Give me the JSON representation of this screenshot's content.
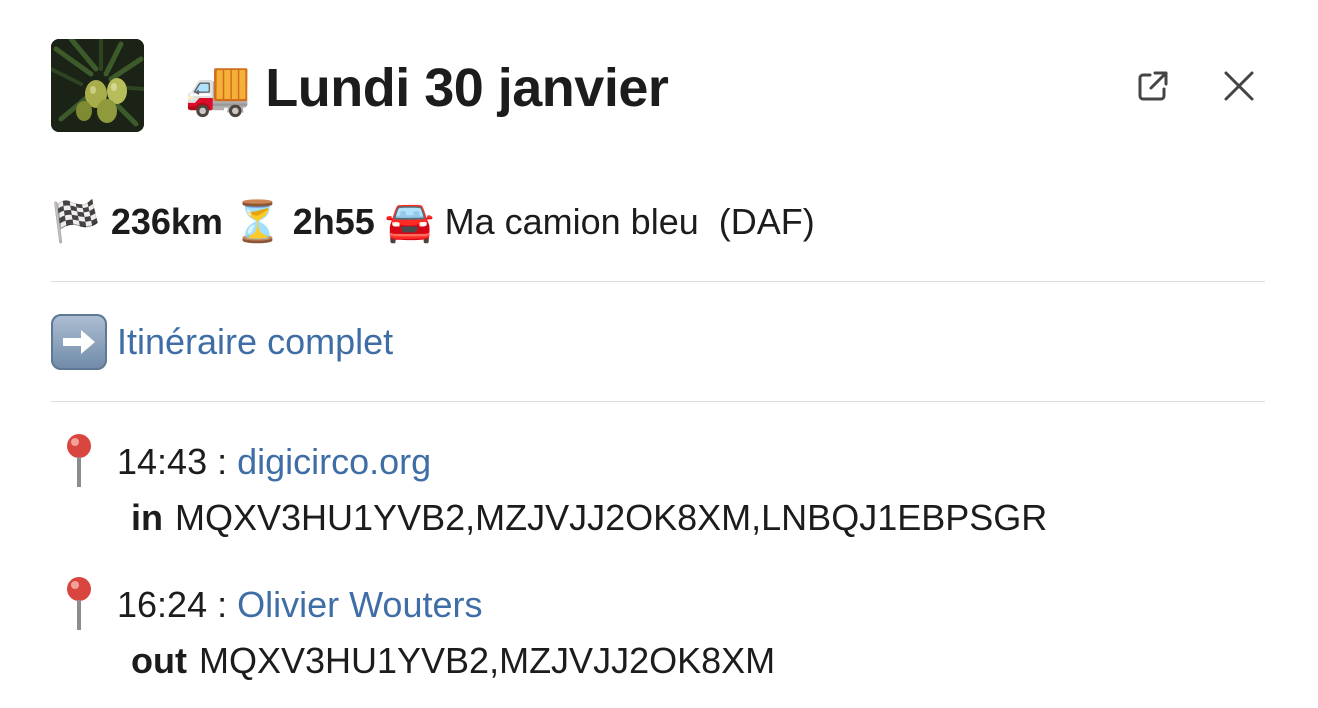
{
  "header": {
    "avatar_icon": "olive-branch-avatar",
    "emoji": "🚚",
    "title": "Lundi 30 janvier",
    "open_external_icon": "external-link-icon",
    "close_icon": "close-icon"
  },
  "stats": {
    "distance_emoji": "🏁",
    "distance": "236km",
    "duration_emoji": "⏳",
    "duration": "2h55",
    "vehicle_emoji": "🚘",
    "vehicle": "Ma camion bleu  (DAF)"
  },
  "route_link": {
    "emoji": "➡️",
    "label": "Itinéraire complet"
  },
  "stops": [
    {
      "time": "14:43 :",
      "place": "digicirco.org",
      "direction": "in",
      "codes": "MQXV3HU1YVB2,MZJVJJ2OK8XM,LNBQJ1EBPSGR"
    },
    {
      "time": "16:24 :",
      "place": "Olivier Wouters",
      "direction": "out",
      "codes": "MQXV3HU1YVB2,MZJVJJ2OK8XM"
    }
  ],
  "colors": {
    "link": "#3f6ea6",
    "text": "#1d1c1d",
    "divider": "#dddddd"
  }
}
